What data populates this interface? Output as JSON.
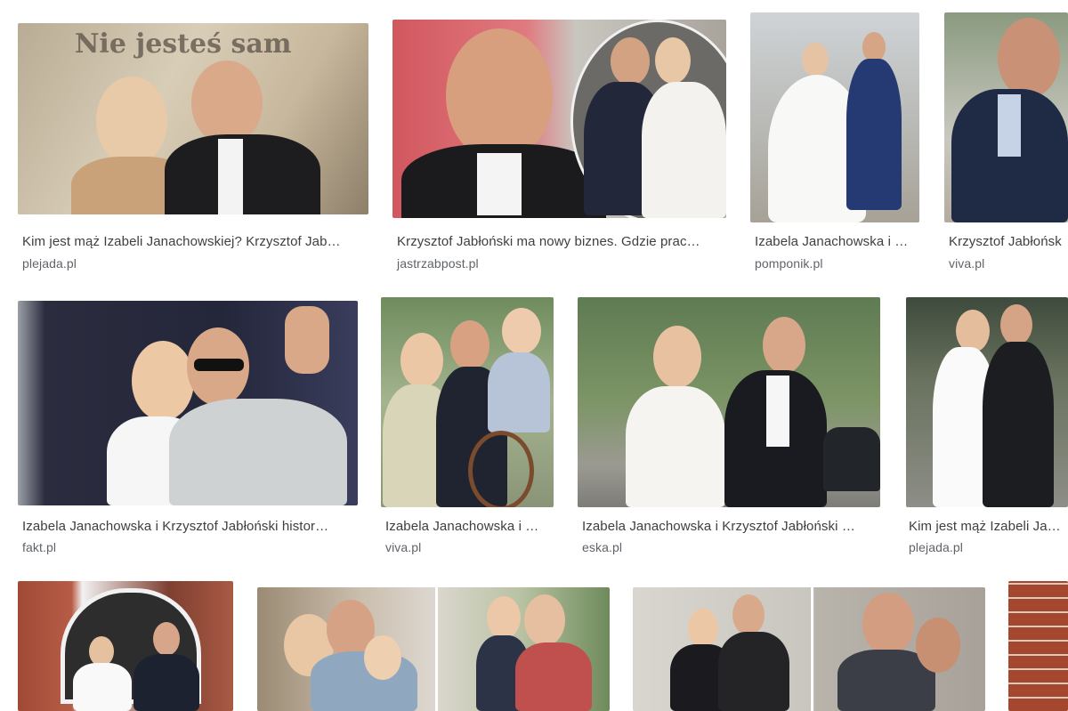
{
  "results": [
    {
      "caption": "Kim jest mąż Izabeli Janachowskiej? Krzysztof Jab…",
      "source": "plejada.pl",
      "image_text": "Nie jesteś sam"
    },
    {
      "caption": "Krzysztof Jabłoński ma nowy biznes. Gdzie prac…",
      "source": "jastrzabpost.pl"
    },
    {
      "caption": "Izabela Janachowska i …",
      "source": "pomponik.pl"
    },
    {
      "caption": "Krzysztof Jabłońsk",
      "source": "viva.pl"
    },
    {
      "caption": "Izabela Janachowska i Krzysztof Jabłoński histor…",
      "source": "fakt.pl"
    },
    {
      "caption": "Izabela Janachowska i …",
      "source": "viva.pl"
    },
    {
      "caption": "Izabela Janachowska i Krzysztof Jabłoński …",
      "source": "eska.pl"
    },
    {
      "caption": "Kim jest mąż Izabeli Ja…",
      "source": "plejada.pl"
    },
    {
      "caption": "",
      "source": ""
    },
    {
      "caption": "",
      "source": ""
    },
    {
      "caption": "",
      "source": ""
    },
    {
      "caption": "",
      "source": ""
    }
  ]
}
